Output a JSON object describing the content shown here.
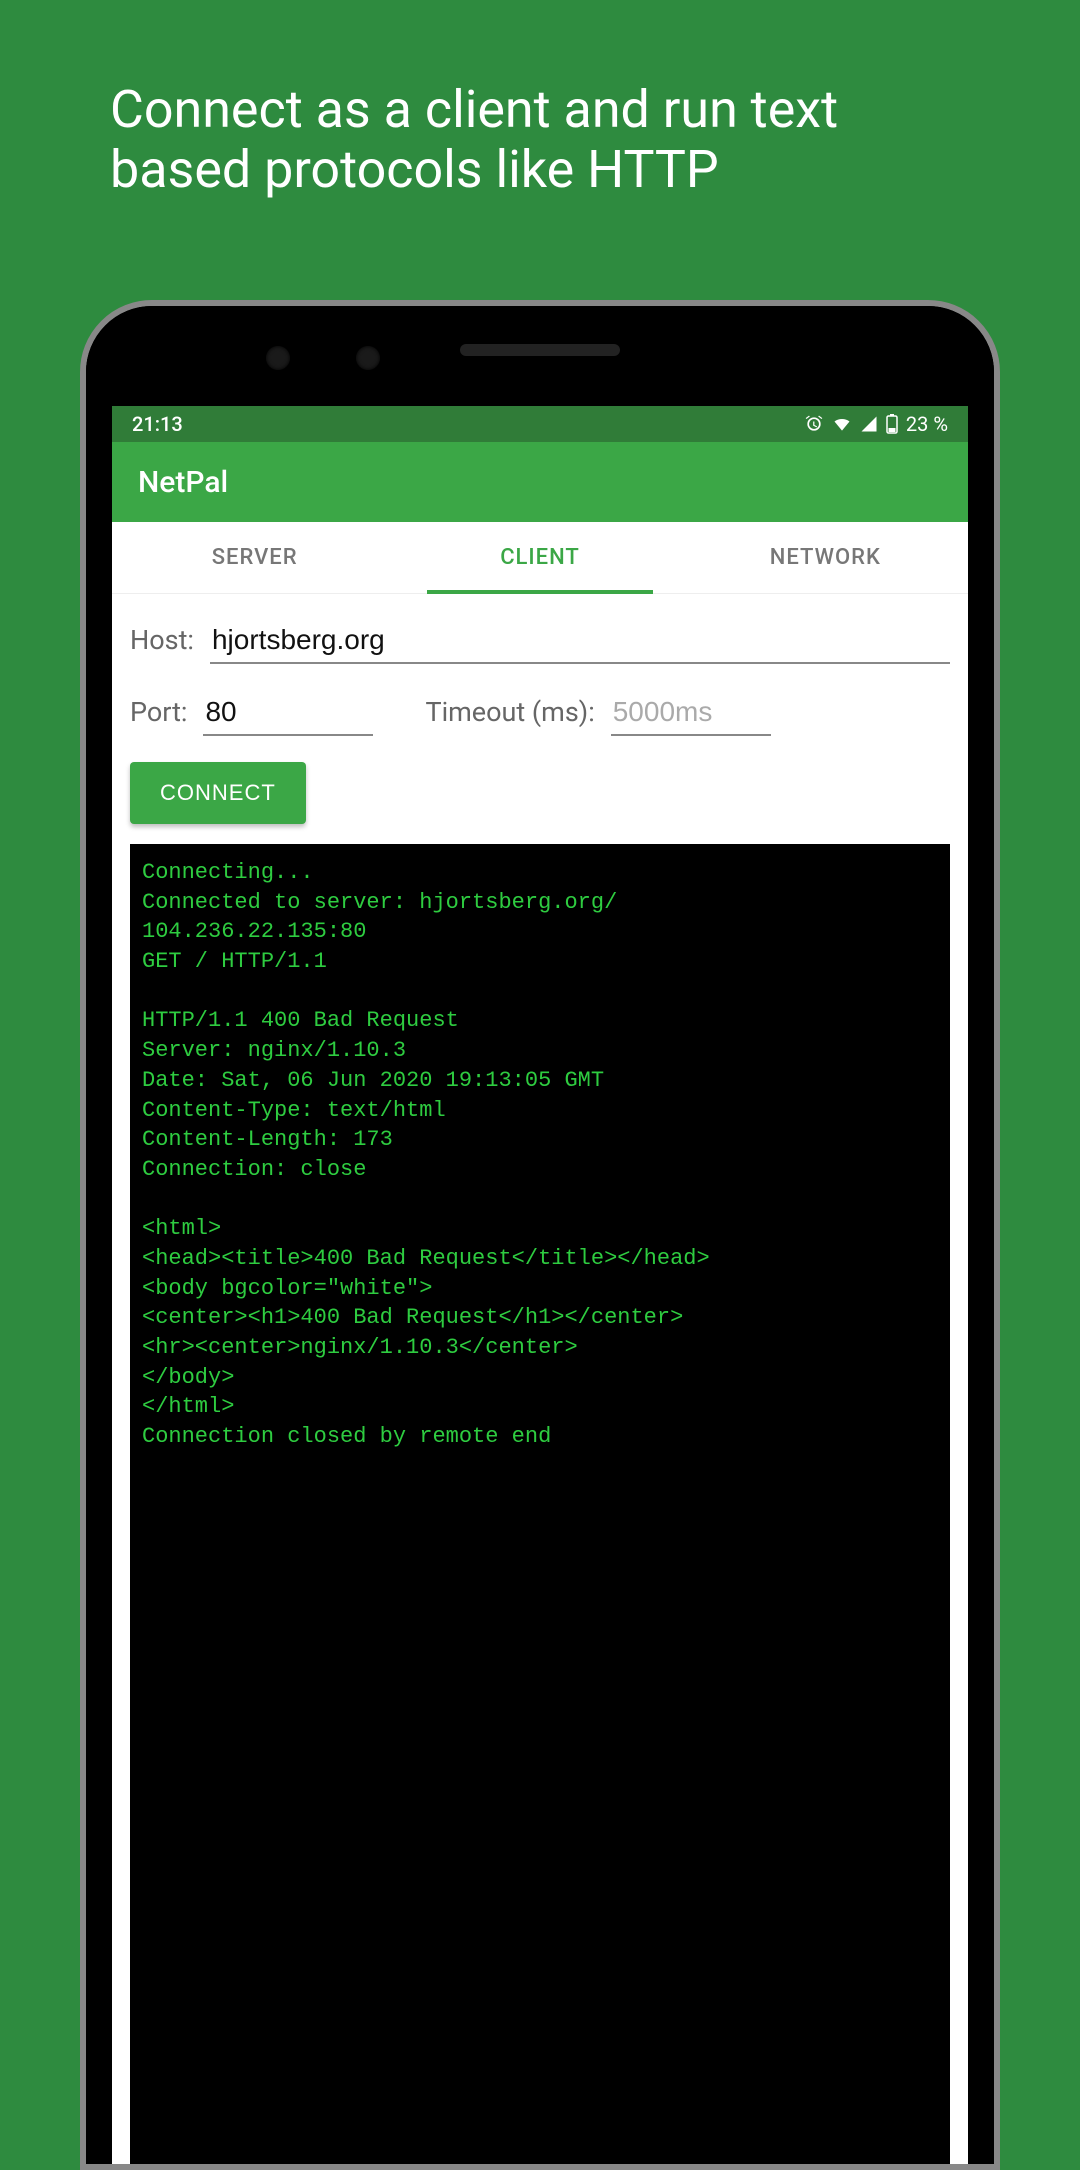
{
  "promo": "Connect as a client and run text based protocols like HTTP",
  "statusbar": {
    "time": "21:13",
    "battery": "23 %"
  },
  "app": {
    "title": "NetPal"
  },
  "tabs": {
    "server": "SERVER",
    "client": "CLIENT",
    "network": "NETWORK",
    "active": "client"
  },
  "form": {
    "host_label": "Host:",
    "host_value": "hjortsberg.org",
    "port_label": "Port:",
    "port_value": "80",
    "timeout_label": "Timeout (ms):",
    "timeout_placeholder": "5000ms",
    "connect_label": "CONNECT"
  },
  "terminal": "Connecting...\nConnected to server: hjortsberg.org/\n104.236.22.135:80\nGET / HTTP/1.1\n\nHTTP/1.1 400 Bad Request\nServer: nginx/1.10.3\nDate: Sat, 06 Jun 2020 19:13:05 GMT\nContent-Type: text/html\nContent-Length: 173\nConnection: close\n\n<html>\n<head><title>400 Bad Request</title></head>\n<body bgcolor=\"white\">\n<center><h1>400 Bad Request</h1></center>\n<hr><center>nginx/1.10.3</center>\n</body>\n</html>\nConnection closed by remote end"
}
